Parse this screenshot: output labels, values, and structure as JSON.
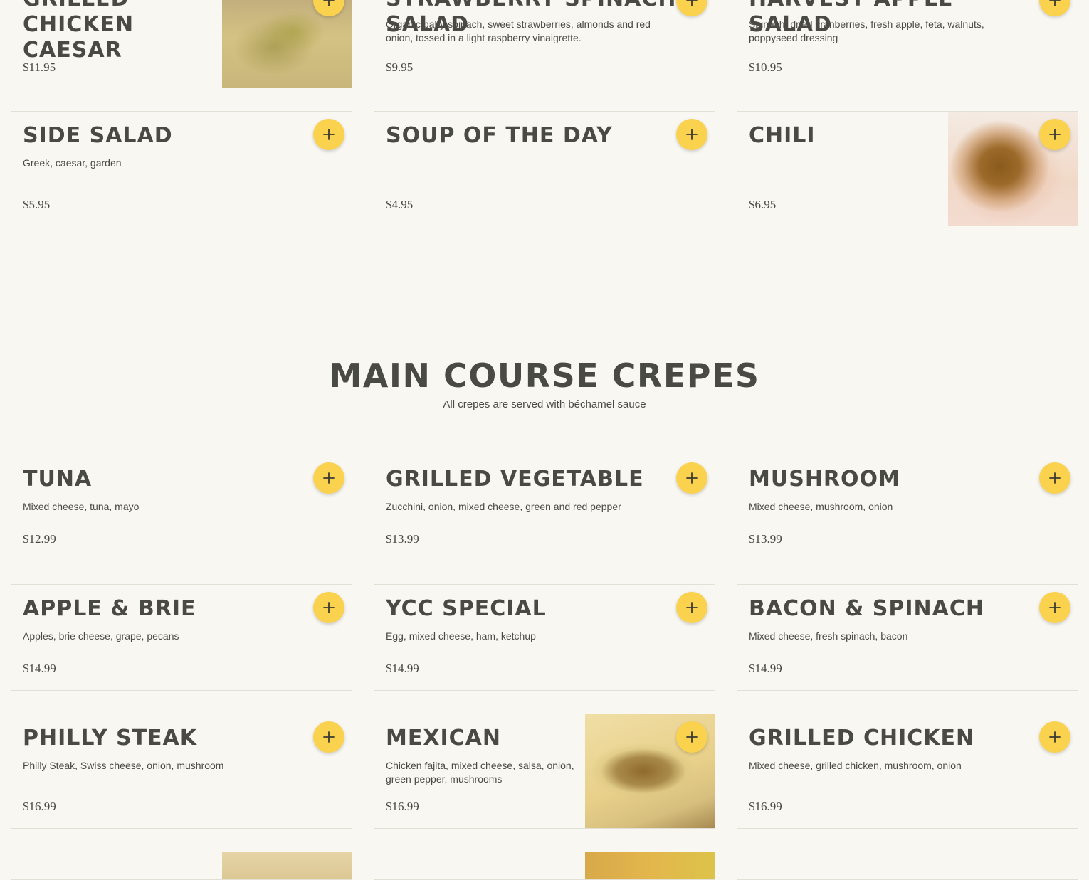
{
  "colors": {
    "background": "#f9f7f2",
    "text": "#4a4a44",
    "card_border": "#e2dfd5",
    "add_button": "#fbd24e"
  },
  "add_icon": "plus-icon",
  "top_items": [
    {
      "name": "Grilled Chicken\nCaesar",
      "description": "",
      "price": "$11.95"
    },
    {
      "name": "Strawberry Spinach Salad",
      "description": "Organic baby spinach, sweet strawberries, almonds and red onion, tossed in a light raspberry vinaigrette.",
      "price": "$9.95"
    },
    {
      "name": "Harvest Apple Salad",
      "description": "Spinach, dried cranberries, fresh apple, feta, walnuts, poppyseed dressing",
      "price": "$10.95"
    }
  ],
  "soups_items": [
    {
      "name": "Side Salad",
      "description": "Greek, caesar, garden",
      "price": "$5.95"
    },
    {
      "name": "Soup of the Day",
      "description": "",
      "price": "$4.95"
    },
    {
      "name": "Chili",
      "description": "",
      "price": "$6.95"
    }
  ],
  "main_section": {
    "title": "MAIN COURSE CREPES",
    "subtitle": "All crepes are served with béchamel sauce"
  },
  "main_items": [
    {
      "name": "Tuna",
      "description": "Mixed cheese, tuna, mayo",
      "price": "$12.99"
    },
    {
      "name": "Grilled Vegetable",
      "description": "Zucchini, onion, mixed cheese, green and red pepper",
      "price": "$13.99"
    },
    {
      "name": "Mushroom",
      "description": "Mixed cheese, mushroom, onion",
      "price": "$13.99"
    },
    {
      "name": "Apple & Brie",
      "description": "Apples, brie cheese, grape, pecans",
      "price": "$14.99"
    },
    {
      "name": "YCC Special",
      "description": "Egg, mixed cheese, ham, ketchup",
      "price": "$14.99"
    },
    {
      "name": "Bacon & Spinach",
      "description": "Mixed cheese, fresh spinach, bacon",
      "price": "$14.99"
    },
    {
      "name": "Philly Steak",
      "description": "Philly Steak, Swiss cheese, onion, mushroom",
      "price": "$16.99"
    },
    {
      "name": "Mexican",
      "description": "Chicken fajita, mixed cheese, salsa, onion, green pepper, mushrooms",
      "price": "$16.99"
    },
    {
      "name": "Grilled Chicken",
      "description": "Mixed cheese, grilled chicken, mushroom, onion",
      "price": "$16.99"
    }
  ]
}
